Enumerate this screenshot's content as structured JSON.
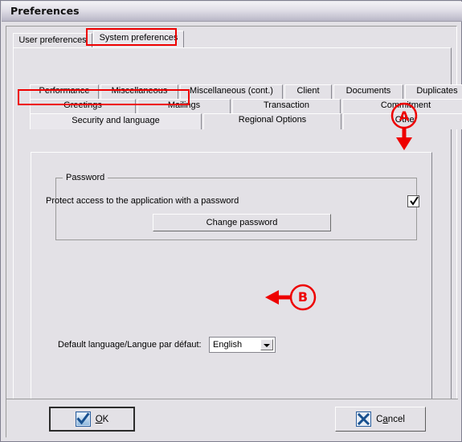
{
  "window": {
    "title": "Preferences"
  },
  "outer_tabs": {
    "items": [
      {
        "label": "User preferences",
        "selected": false
      },
      {
        "label": "System preferences",
        "selected": true
      }
    ]
  },
  "inner_tabs": {
    "row1": [
      {
        "label": "Performance"
      },
      {
        "label": "Miscellaneous"
      },
      {
        "label": "Miscellaneous (cont.)"
      },
      {
        "label": "Client"
      },
      {
        "label": "Documents"
      },
      {
        "label": "Duplicates"
      }
    ],
    "row2": [
      {
        "label": "Greetings"
      },
      {
        "label": "Mailings"
      },
      {
        "label": "Transaction"
      },
      {
        "label": "Commitment"
      }
    ],
    "row3": [
      {
        "label": "Security and language",
        "selected": true
      },
      {
        "label": "Regional Options",
        "selected": false
      },
      {
        "label": "Other",
        "selected": false
      }
    ]
  },
  "password_group": {
    "legend": "Password",
    "protect_label": "Protect access to the application with a password",
    "protect_checked": true,
    "change_password_label": "Change password"
  },
  "language": {
    "label": "Default language/Langue par défaut:",
    "value": "English",
    "options": [
      "English"
    ]
  },
  "footer": {
    "ok_label_pre": "",
    "ok_label_accel": "O",
    "ok_label_post": "K",
    "cancel_label_pre": "C",
    "cancel_label_accel": "a",
    "cancel_label_post": "ncel",
    "ok_icon": "check-icon",
    "cancel_icon": "x-icon"
  },
  "annotations": [
    {
      "id": "A",
      "letter": "A",
      "target": "protect-password-checkbox",
      "color": "#ee0000"
    },
    {
      "id": "B",
      "letter": "B",
      "target": "default-language-select",
      "color": "#ee0000"
    }
  ],
  "colors": {
    "annotation": "#ee0000",
    "face": "#e3e1e6",
    "field": "#ffffff",
    "accent_blue": "#1f5fa9"
  }
}
